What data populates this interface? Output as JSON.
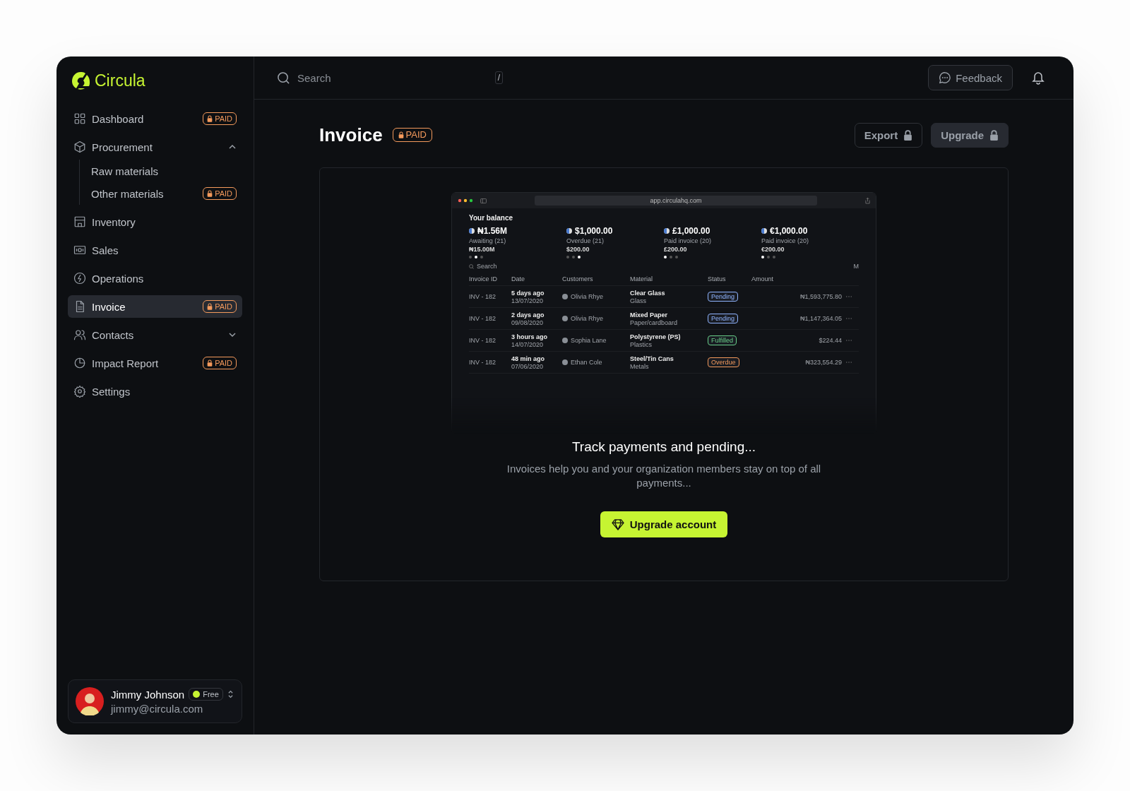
{
  "brand": {
    "name": "Circula"
  },
  "sidebar": {
    "items": [
      {
        "kind": "link",
        "label": "Dashboard",
        "badge": "PAID",
        "selected": false
      },
      {
        "kind": "group",
        "label": "Procurement",
        "expanded": true,
        "selected": false,
        "children": [
          {
            "label": "Raw materials",
            "selected": false
          },
          {
            "label": "Other materials",
            "badge": "PAID",
            "selected": false
          }
        ]
      },
      {
        "kind": "link",
        "label": "Inventory",
        "selected": false
      },
      {
        "kind": "link",
        "label": "Sales",
        "selected": false
      },
      {
        "kind": "link",
        "label": "Operations",
        "selected": false
      },
      {
        "kind": "link",
        "label": "Invoice",
        "badge": "PAID",
        "selected": true
      },
      {
        "kind": "group",
        "label": "Contacts",
        "expanded": false,
        "selected": false
      },
      {
        "kind": "link",
        "label": "Impact Report",
        "badge": "PAID",
        "selected": false
      },
      {
        "kind": "link",
        "label": "Settings",
        "selected": false
      }
    ]
  },
  "user": {
    "name": "Jimmy Johnson",
    "plan": "Free",
    "email": "jimmy@circula.com"
  },
  "topbar": {
    "search": {
      "placeholder": "Search",
      "shortcut": "/"
    },
    "feedback": "Feedback"
  },
  "page": {
    "title": "Invoice",
    "badge": "PAID",
    "actions": [
      {
        "label": "Export",
        "kind": "outline"
      },
      {
        "label": "Upgrade",
        "kind": "filled"
      }
    ]
  },
  "empty_state": {
    "preview": {
      "url": "app.circulahq.com",
      "balance_title": "Your balance",
      "balances": [
        {
          "amount": "₦1.56M",
          "caption": "Awaiting (21)",
          "sub_amount": "₦15.00M",
          "dots": [
            {
              "selected": false
            },
            {
              "selected": true
            },
            {
              "selected": false
            }
          ]
        },
        {
          "amount": "$1,000.00",
          "caption": "Overdue (21)",
          "sub_amount": "$200.00",
          "dots": [
            {
              "selected": false
            },
            {
              "selected": false
            },
            {
              "selected": true
            }
          ]
        },
        {
          "amount": "£1,000.00",
          "caption": "Paid invoice (20)",
          "sub_amount": "£200.00",
          "dots": [
            {
              "selected": true
            },
            {
              "selected": false
            },
            {
              "selected": false
            }
          ]
        },
        {
          "amount": "€1,000.00",
          "caption": "Paid invoice (20)",
          "sub_amount": "€200.00",
          "dots": [
            {
              "selected": true
            },
            {
              "selected": false
            },
            {
              "selected": false
            }
          ]
        }
      ],
      "search": {
        "placeholder": "Search",
        "shortcut": "M"
      },
      "columns": [
        "Invoice ID",
        "Date",
        "Customers",
        "Material",
        "Status",
        "Amount"
      ],
      "rows": [
        {
          "id": "INV - 182",
          "when": "5 days ago",
          "date": "13/07/2020",
          "customer": "Olivia Rhye",
          "material": "Clear Glass",
          "category": "Glass",
          "status": "Pending",
          "color": "#8fb4ff",
          "amount": "₦1,593,775.80"
        },
        {
          "id": "INV - 182",
          "when": "2 days ago",
          "date": "09/08/2020",
          "customer": "Olivia Rhye",
          "material": "Mixed Paper",
          "category": "Paper/cardboard",
          "status": "Pending",
          "color": "#8fb4ff",
          "amount": "₦1,147,364.05"
        },
        {
          "id": "INV - 182",
          "when": "3 hours ago",
          "date": "14/07/2020",
          "customer": "Sophia Lane",
          "material": "Polystyrene (PS)",
          "category": "Plastics",
          "status": "Fulfilled",
          "color": "#6ad08a",
          "amount": "$224.44"
        },
        {
          "id": "INV - 182",
          "when": "48 min ago",
          "date": "07/06/2020",
          "customer": "Ethan Cole",
          "material": "Steel/Tin Cans",
          "category": "Metals",
          "status": "Overdue",
          "color": "#f49a5c",
          "amount": "₦323,554.29"
        }
      ]
    },
    "heading": "Track payments and pending...",
    "text": "Invoices help you and your organization members stay on top of all payments...",
    "button": "Upgrade account"
  }
}
